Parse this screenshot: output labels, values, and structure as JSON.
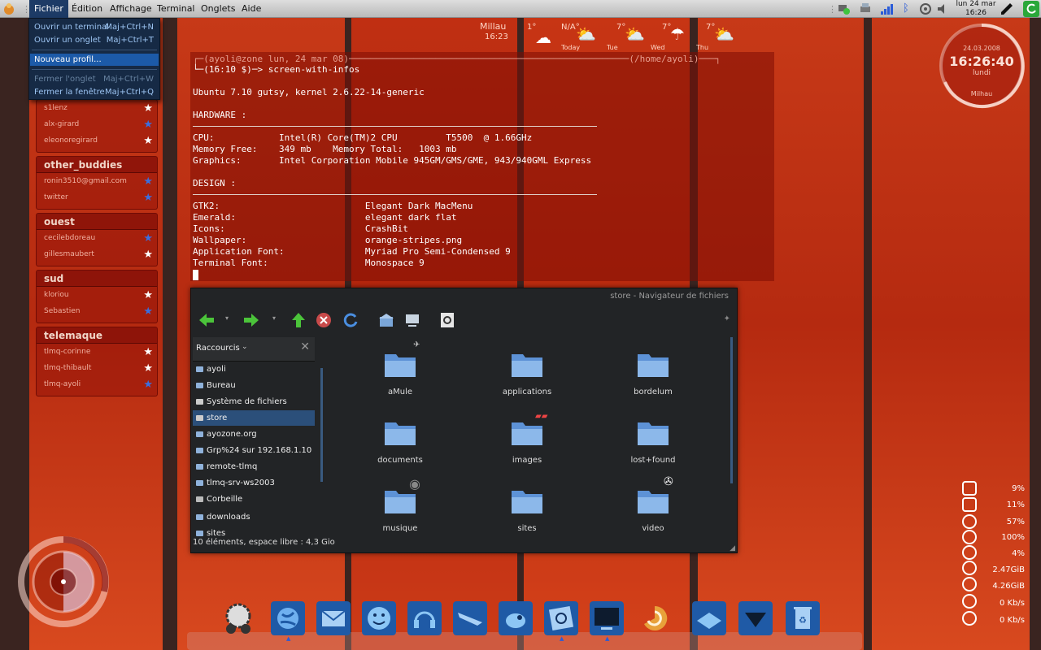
{
  "topbar": {
    "menus": [
      "Fichier",
      "Édition",
      "Affichage",
      "Terminal",
      "Onglets",
      "Aide"
    ],
    "clock_date": "lun 24 mar",
    "clock_time": "16:26"
  },
  "file_menu": {
    "items": [
      {
        "label": "Ouvrir un terminal",
        "shortcut": "Maj+Ctrl+N"
      },
      {
        "label": "Ouvrir un onglet",
        "shortcut": "Maj+Ctrl+T"
      },
      {
        "label": "Nouveau profil...",
        "shortcut": ""
      },
      {
        "label": "Fermer l'onglet",
        "shortcut": "Maj+Ctrl+W"
      },
      {
        "label": "Fermer la fenêtre",
        "shortcut": "Maj+Ctrl+Q"
      }
    ]
  },
  "weather": {
    "city": "Millau",
    "time": "16:23",
    "days": [
      {
        "temp": "1°",
        "label": ""
      },
      {
        "temp": "N/A°",
        "label": "Today"
      },
      {
        "temp": "7°",
        "label": "Tue"
      },
      {
        "temp": "7°",
        "label": "Wed"
      },
      {
        "temp": "7°",
        "label": "Thu"
      }
    ]
  },
  "big_clock": {
    "date": "24.03.2008",
    "time": "16:26:40",
    "day": "lundi",
    "city": "Milhau"
  },
  "buddies": {
    "top": [
      "s1lenz",
      "alx-girard",
      "eleonoregirard"
    ],
    "groups": [
      {
        "name": "other_buddies",
        "items": [
          "ronin3510@gmail.com",
          "twitter"
        ]
      },
      {
        "name": "ouest",
        "items": [
          "cecilebdoreau",
          "gillesmaubert"
        ]
      },
      {
        "name": "sud",
        "items": [
          "kloriou",
          "Sebastien"
        ]
      },
      {
        "name": "telemaque",
        "items": [
          "tlmq-corinne",
          "tlmq-thibault",
          "tlmq-ayoli"
        ]
      }
    ],
    "colors": {
      "white_star": "#ffffff",
      "blue_star": "#3a6fe0"
    }
  },
  "terminal": {
    "prompt1": "┌─(ayoli@zone lun, 24 mar 08)────────────────────────────────────────────────────(/home/ayoli)───┐",
    "prompt2": "└─(16:10 $)─> screen-with-infos",
    "os": "Ubuntu 7.10 gutsy, kernel 2.6.22-14-generic",
    "hardware_header": "HARDWARE :",
    "cpu": "CPU:            Intel(R) Core(TM)2 CPU         T5500  @ 1.66GHz",
    "memory": "Memory Free:    349 mb    Memory Total:   1003 mb",
    "graphics": "Graphics:       Intel Corporation Mobile 945GM/GMS/GME, 943/940GML Express",
    "design_header": "DESIGN :",
    "gtk": "GTK2:                           Elegant Dark MacMenu",
    "emerald": "Emerald:                        elegant dark flat",
    "icons": "Icons:                          CrashBit",
    "wallpaper": "Wallpaper:                      orange-stripes.png",
    "appfont": "Application Font:               Myriad Pro Semi-Condensed 9",
    "termfont": "Terminal Font:                  Monospace 9"
  },
  "file_manager": {
    "title": "store - Navigateur de fichiers",
    "shortcuts_label": "Raccourcis",
    "places": [
      "ayoli",
      "Bureau",
      "Système de fichiers",
      "store",
      "ayozone.org",
      "Grp%24 sur 192.168.1.10",
      "remote-tlmq",
      "tlmq-srv-ws2003",
      "Corbeille",
      "downloads",
      "sites"
    ],
    "folders": [
      "aMule",
      "applications",
      "bordelum",
      "documents",
      "images",
      "lost+found",
      "musique",
      "sites",
      "video"
    ],
    "status": "10 éléments, espace libre : 4,3 Gio"
  },
  "system_stats": {
    "values": [
      "9%",
      "11%",
      "57%",
      "100%",
      "4%",
      "2.47GiB",
      "4.26GiB",
      "0 Kb/s",
      "0 Kb/s"
    ]
  },
  "dock": {
    "icons": [
      "settings-binoculars-icon",
      "globe-icon",
      "mail-icon",
      "smiley-icon",
      "headphones-icon",
      "airplane-icon",
      "gimp-icon",
      "photo-icon",
      "terminal-icon",
      "shell-icon",
      "disk-icon",
      "download-icon",
      "trash-icon"
    ]
  }
}
